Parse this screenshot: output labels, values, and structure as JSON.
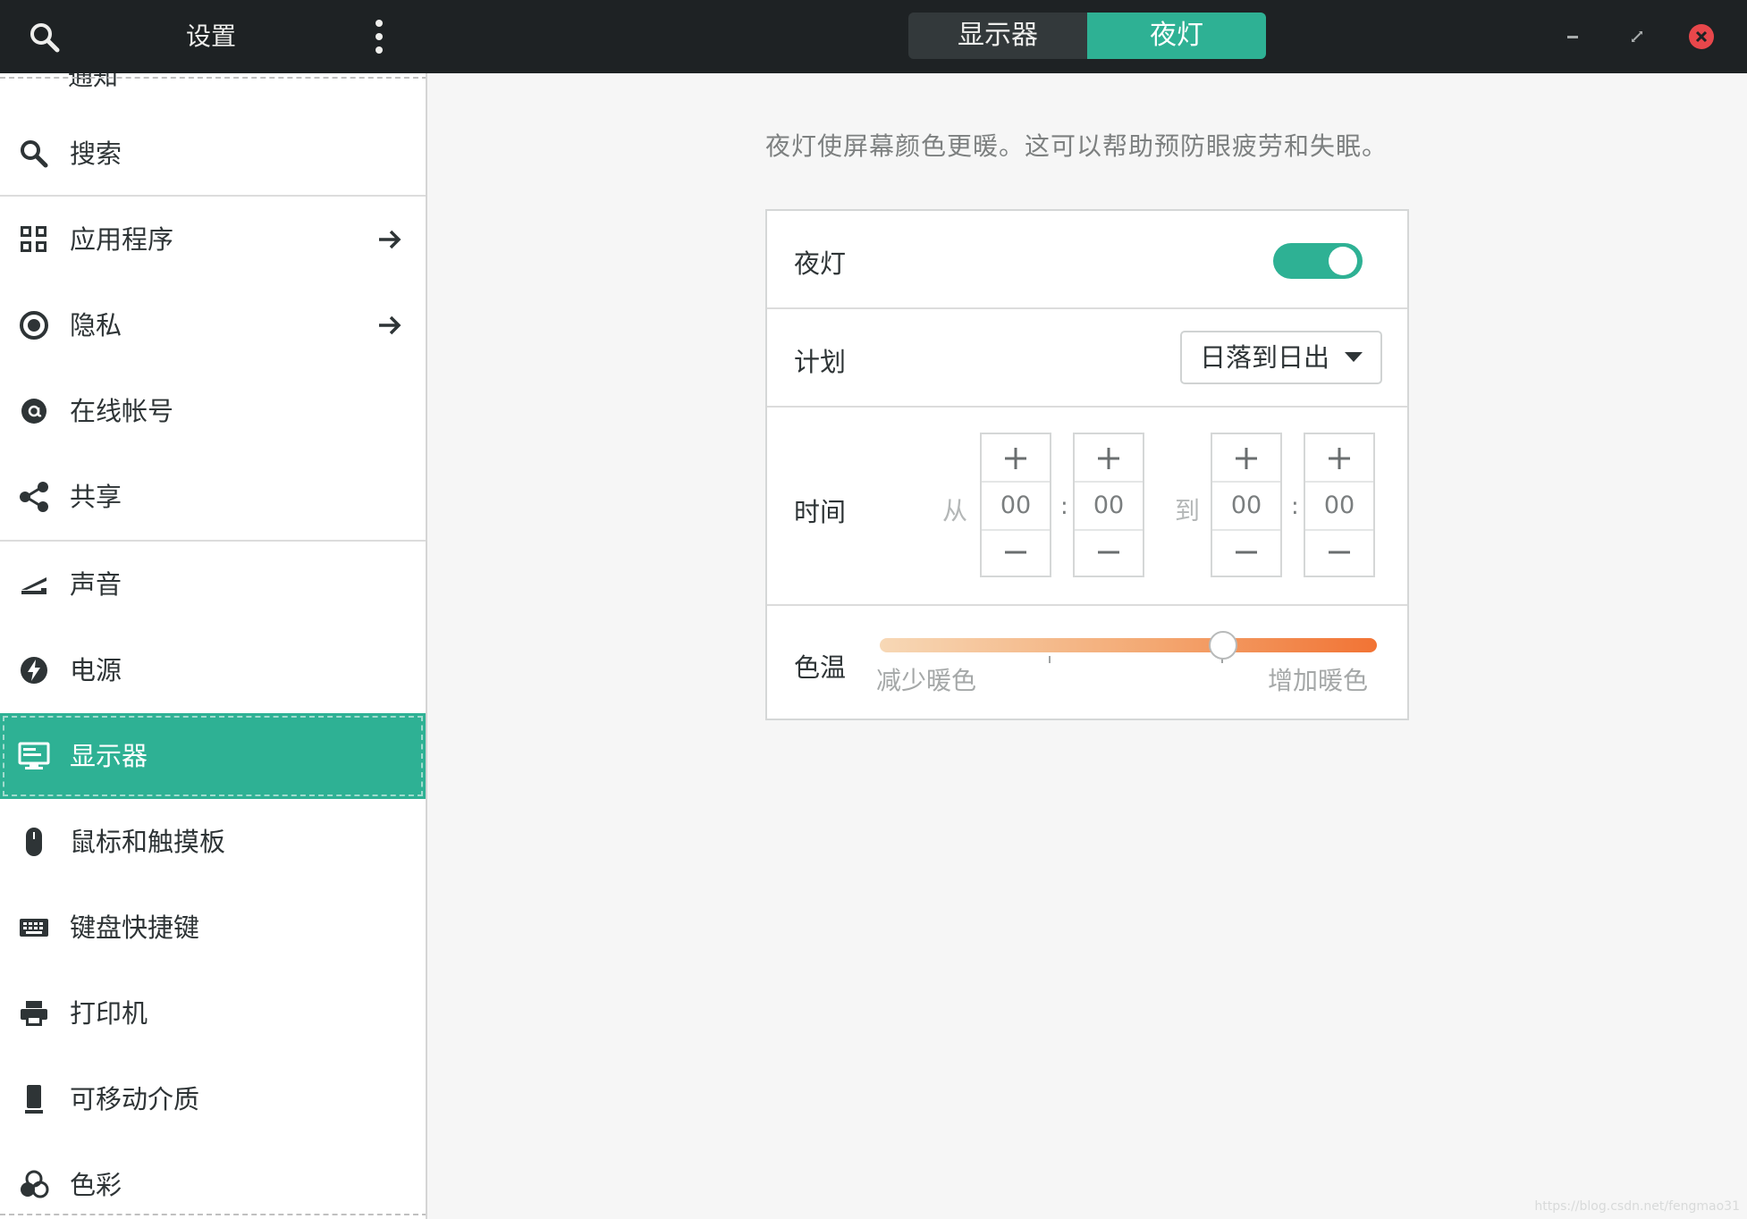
{
  "header": {
    "title": "设置",
    "tabs": [
      {
        "label": "显示器",
        "active": false
      },
      {
        "label": "夜灯",
        "active": true
      }
    ]
  },
  "sidebar": {
    "partial_item": "通知",
    "items": [
      {
        "label": "搜索",
        "icon": "search-icon"
      },
      {
        "label": "应用程序",
        "icon": "apps-grid-icon",
        "arrow": true
      },
      {
        "label": "隐私",
        "icon": "privacy-icon",
        "arrow": true
      },
      {
        "label": "在线帐号",
        "icon": "at-sign-icon"
      },
      {
        "label": "共享",
        "icon": "share-icon"
      },
      {
        "label": "声音",
        "icon": "sound-icon"
      },
      {
        "label": "电源",
        "icon": "power-icon"
      },
      {
        "label": "显示器",
        "icon": "display-icon",
        "active": true
      },
      {
        "label": "鼠标和触摸板",
        "icon": "mouse-icon"
      },
      {
        "label": "键盘快捷键",
        "icon": "keyboard-icon"
      },
      {
        "label": "打印机",
        "icon": "printer-icon"
      },
      {
        "label": "可移动介质",
        "icon": "removable-media-icon"
      },
      {
        "label": "色彩",
        "icon": "color-icon"
      }
    ]
  },
  "main": {
    "description": "夜灯使屏幕颜色更暖。这可以帮助预防眼疲劳和失眠。",
    "night_light": {
      "label": "夜灯",
      "enabled": true
    },
    "schedule": {
      "label": "计划",
      "value": "日落到日出"
    },
    "time": {
      "label": "时间",
      "from_label": "从",
      "to_label": "到",
      "from_hours": "00",
      "from_minutes": "00",
      "to_hours": "00",
      "to_minutes": "00",
      "separator": ":"
    },
    "color_temperature": {
      "label": "色温",
      "min_label": "减少暖色",
      "max_label": "增加暖色",
      "value_fraction": 0.67
    }
  },
  "colors": {
    "accent": "#2eb194",
    "headerbar": "#1e2224",
    "close_button": "#e8474b",
    "slider_start": "#f7d8b6",
    "slider_end": "#f27334"
  },
  "watermark": "https://blog.csdn.net/fengmao31"
}
